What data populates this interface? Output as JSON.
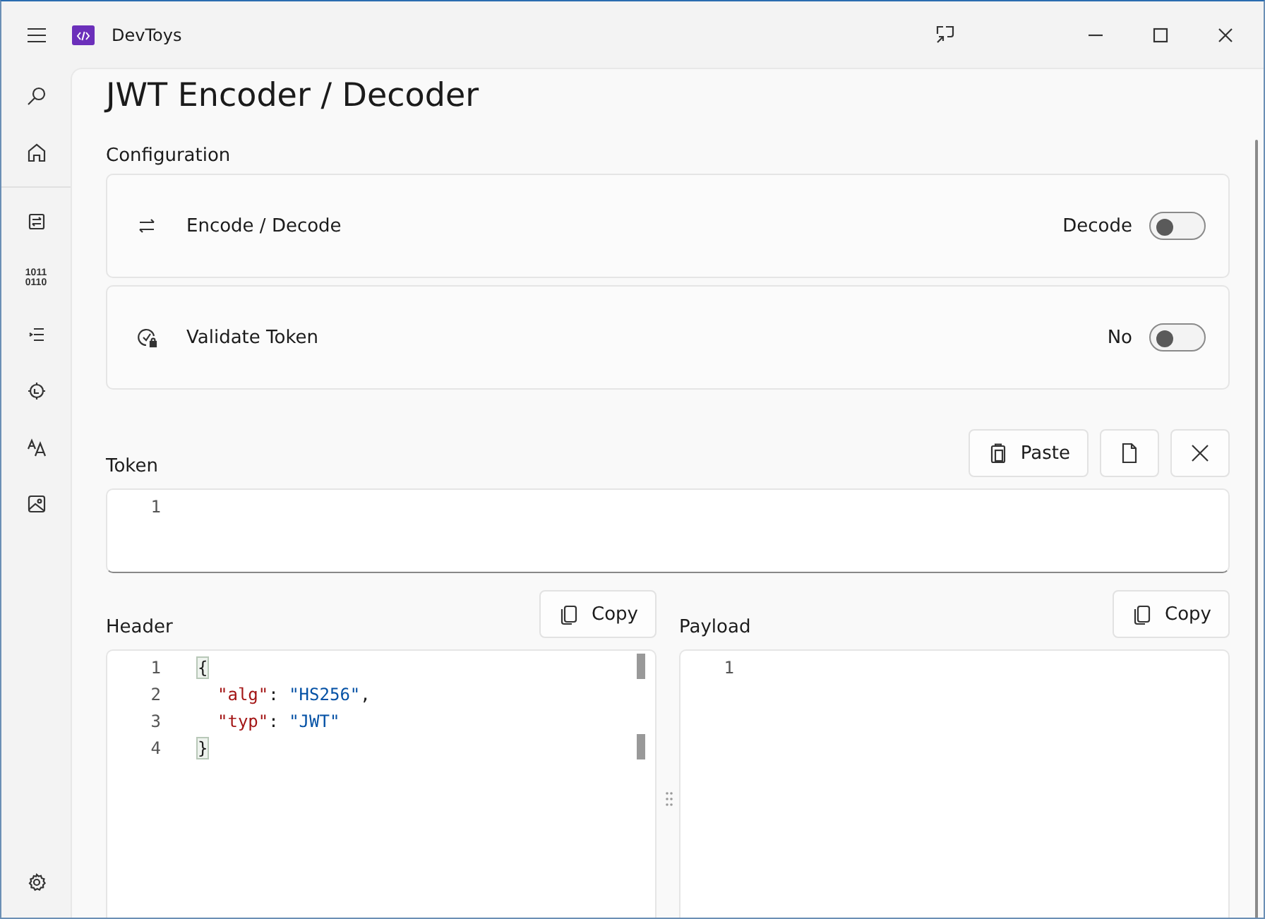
{
  "window": {
    "title": "DevToys"
  },
  "nav_items": [
    {
      "kind": "search"
    },
    {
      "kind": "home"
    },
    {
      "kind": "converter"
    },
    {
      "kind": "binary",
      "glyph_lines": [
        "1011",
        "0110"
      ]
    },
    {
      "kind": "formatter"
    },
    {
      "kind": "encoder"
    },
    {
      "kind": "text"
    },
    {
      "kind": "image"
    }
  ],
  "page_title": "JWT Encoder / Decoder",
  "configuration": {
    "heading": "Configuration",
    "settings": [
      {
        "kind": "swap",
        "label": "Encode / Decode",
        "value": "Decode",
        "on": false
      },
      {
        "kind": "validate",
        "label": "Validate Token",
        "value": "No",
        "on": false
      }
    ]
  },
  "token": {
    "label": "Token",
    "buttons": [
      {
        "kind": "paste",
        "label": "Paste"
      },
      {
        "kind": "file"
      },
      {
        "kind": "clear"
      }
    ],
    "lines": [
      {
        "number": "1"
      }
    ]
  },
  "header": {
    "label": "Header",
    "copy": "Copy",
    "lines": [
      {
        "number": "1",
        "indented": false,
        "tokens": [
          {
            "kind": "bracket",
            "text": "{"
          }
        ]
      },
      {
        "number": "2",
        "indented": true,
        "tokens": [
          {
            "kind": "key",
            "text": "\"alg\""
          },
          {
            "kind": "punct",
            "text": ": "
          },
          {
            "kind": "string",
            "text": "\"HS256\""
          },
          {
            "kind": "punct",
            "text": ","
          }
        ]
      },
      {
        "number": "3",
        "indented": true,
        "tokens": [
          {
            "kind": "key",
            "text": "\"typ\""
          },
          {
            "kind": "punct",
            "text": ": "
          },
          {
            "kind": "string",
            "text": "\"JWT\""
          }
        ]
      },
      {
        "number": "4",
        "indented": false,
        "tokens": [
          {
            "kind": "bracket",
            "text": "}"
          }
        ]
      }
    ]
  },
  "payload": {
    "label": "Payload",
    "copy": "Copy",
    "lines": [
      {
        "number": "1"
      }
    ]
  }
}
